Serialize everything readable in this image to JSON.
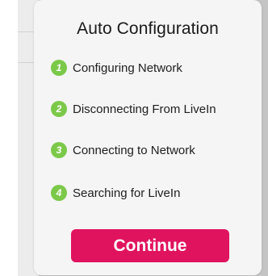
{
  "dialog": {
    "title": "Auto Configuration",
    "steps": [
      {
        "number": "1",
        "label": "Configuring Network"
      },
      {
        "number": "2",
        "label": "Disconnecting From LiveIn"
      },
      {
        "number": "3",
        "label": "Connecting to Network"
      },
      {
        "number": "4",
        "label": "Searching for LiveIn"
      }
    ],
    "continue_label": "Continue"
  },
  "colors": {
    "accent": "#e0135e",
    "step_badge": "#7cc94a",
    "dialog_background": "#f5f5f5",
    "backdrop": "#c4c4c4"
  }
}
